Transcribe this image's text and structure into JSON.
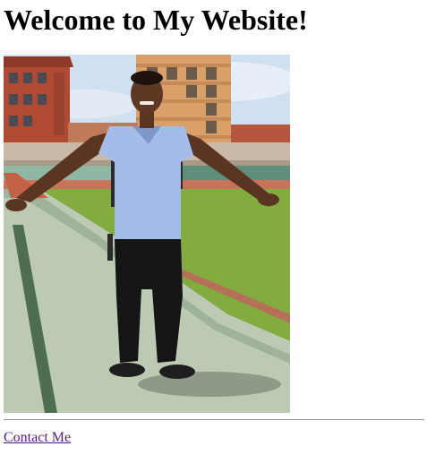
{
  "page": {
    "heading": "Welcome to My Website!",
    "contact_link_label": "Contact Me"
  },
  "colors": {
    "link": "#551a8b",
    "sky": "#c9dcef",
    "building_brick": "#b24a32",
    "building_tan": "#d9a26a",
    "grass": "#7ea53a",
    "track": "#c86a4a",
    "concrete": "#b9c7b2",
    "shirt": "#9fb7e6",
    "pants": "#1a1a1a"
  }
}
